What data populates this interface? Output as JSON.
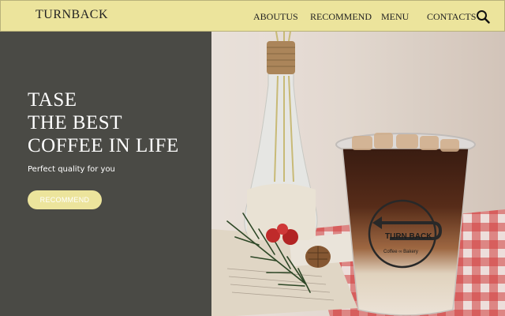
{
  "header": {
    "logo": "TURNBACK",
    "nav": [
      {
        "label": "ABOUTUS"
      },
      {
        "label": "RECOMMEND"
      },
      {
        "label": "MENU"
      },
      {
        "label": "CONTACTS"
      }
    ],
    "search_icon": "search-icon"
  },
  "hero": {
    "lines": [
      "TASE",
      "THE BEST",
      "COFFEE IN LIFE"
    ],
    "subtitle": "Perfect quality for you",
    "button_label": "RECOMMEND"
  },
  "photo": {
    "cup_logo_line1": "TURN BACK",
    "cup_logo_line2": "Coffee ∞ Bakery"
  },
  "colors": {
    "header_bg": "#ece49c",
    "panel_bg": "#4a4a45",
    "button_bg": "#ece49c"
  }
}
